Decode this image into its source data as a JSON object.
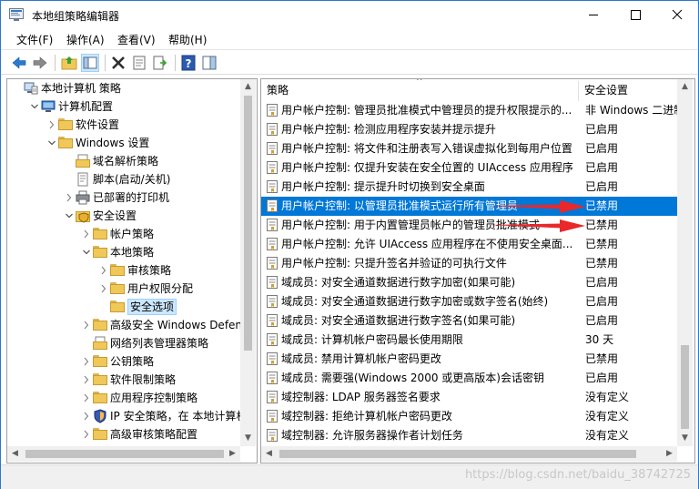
{
  "window": {
    "title": "本地组策略编辑器"
  },
  "menu": [
    "文件(F)",
    "操作(A)",
    "查看(V)",
    "帮助(H)"
  ],
  "tree": [
    {
      "label": "本地计算机 策略",
      "indent": 0,
      "expander": "",
      "icon": "computer-policy-icon"
    },
    {
      "label": "计算机配置",
      "indent": 1,
      "expander": "open",
      "icon": "computer-icon"
    },
    {
      "label": "软件设置",
      "indent": 2,
      "expander": "closed",
      "icon": "folder-icon"
    },
    {
      "label": "Windows 设置",
      "indent": 2,
      "expander": "open",
      "icon": "folder-icon"
    },
    {
      "label": "域名解析策略",
      "indent": 3,
      "expander": "",
      "icon": "doc-folder-icon"
    },
    {
      "label": "脚本(启动/关机)",
      "indent": 3,
      "expander": "",
      "icon": "script-icon"
    },
    {
      "label": "已部署的打印机",
      "indent": 3,
      "expander": "closed",
      "icon": "printer-icon"
    },
    {
      "label": "安全设置",
      "indent": 3,
      "expander": "open",
      "icon": "security-folder-icon"
    },
    {
      "label": "帐户策略",
      "indent": 4,
      "expander": "closed",
      "icon": "folder-icon"
    },
    {
      "label": "本地策略",
      "indent": 4,
      "expander": "open",
      "icon": "folder-icon"
    },
    {
      "label": "审核策略",
      "indent": 5,
      "expander": "closed",
      "icon": "folder-icon"
    },
    {
      "label": "用户权限分配",
      "indent": 5,
      "expander": "closed",
      "icon": "folder-icon"
    },
    {
      "label": "安全选项",
      "indent": 5,
      "expander": "",
      "icon": "folder-icon",
      "selected": true
    },
    {
      "label": "高级安全 Windows Defend",
      "indent": 4,
      "expander": "closed",
      "icon": "folder-icon"
    },
    {
      "label": "网络列表管理器策略",
      "indent": 4,
      "expander": "",
      "icon": "doc-folder-icon"
    },
    {
      "label": "公钥策略",
      "indent": 4,
      "expander": "closed",
      "icon": "folder-icon"
    },
    {
      "label": "软件限制策略",
      "indent": 4,
      "expander": "closed",
      "icon": "folder-icon"
    },
    {
      "label": "应用程序控制策略",
      "indent": 4,
      "expander": "closed",
      "icon": "folder-icon"
    },
    {
      "label": "IP 安全策略，在 本地计算机",
      "indent": 4,
      "expander": "closed",
      "icon": "ipsec-icon"
    },
    {
      "label": "高级审核策略配置",
      "indent": 4,
      "expander": "closed",
      "icon": "folder-icon"
    }
  ],
  "columns": {
    "policy": "策略",
    "setting": "安全设置"
  },
  "policies": [
    {
      "name": "用户帐户控制: 管理员批准模式中管理员的提升权限提示的...",
      "value": "非 Windows 二进制"
    },
    {
      "name": "用户帐户控制: 检测应用程序安装并提示提升",
      "value": "已启用"
    },
    {
      "name": "用户帐户控制: 将文件和注册表写入错误虚拟化到每用户位置",
      "value": "已启用"
    },
    {
      "name": "用户帐户控制: 仅提升安装在安全位置的 UIAccess 应用程序",
      "value": "已启用"
    },
    {
      "name": "用户帐户控制: 提示提升时切换到安全桌面",
      "value": "已启用"
    },
    {
      "name": "用户帐户控制: 以管理员批准模式运行所有管理员",
      "value": "已禁用",
      "selected": true,
      "arrow": true
    },
    {
      "name": "用户帐户控制: 用于内置管理员帐户的管理员批准模式",
      "value": "已禁用",
      "arrow": true
    },
    {
      "name": "用户帐户控制: 允许 UIAccess 应用程序在不使用安全桌面...",
      "value": "已禁用"
    },
    {
      "name": "用户帐户控制: 只提升签名并验证的可执行文件",
      "value": "已禁用"
    },
    {
      "name": "域成员: 对安全通道数据进行数字加密(如果可能)",
      "value": "已启用"
    },
    {
      "name": "域成员: 对安全通道数据进行数字加密或数字签名(始终)",
      "value": "已启用"
    },
    {
      "name": "域成员: 对安全通道数据进行数字签名(如果可能)",
      "value": "已启用"
    },
    {
      "name": "域成员: 计算机帐户密码最长使用期限",
      "value": "30 天"
    },
    {
      "name": "域成员: 禁用计算机帐户密码更改",
      "value": "已禁用"
    },
    {
      "name": "域成员: 需要强(Windows 2000 或更高版本)会话密钥",
      "value": "已启用"
    },
    {
      "name": "域控制器: LDAP 服务器签名要求",
      "value": "没有定义"
    },
    {
      "name": "域控制器: 拒绝计算机帐户密码更改",
      "value": "没有定义"
    },
    {
      "name": "域控制器: 允许服务器操作者计划任务",
      "value": "没有定义"
    }
  ],
  "watermark": "https://blog.csdn.net/baidu_38742725",
  "colors": {
    "selection": "#0078d7",
    "arrow": "#e8282a"
  }
}
